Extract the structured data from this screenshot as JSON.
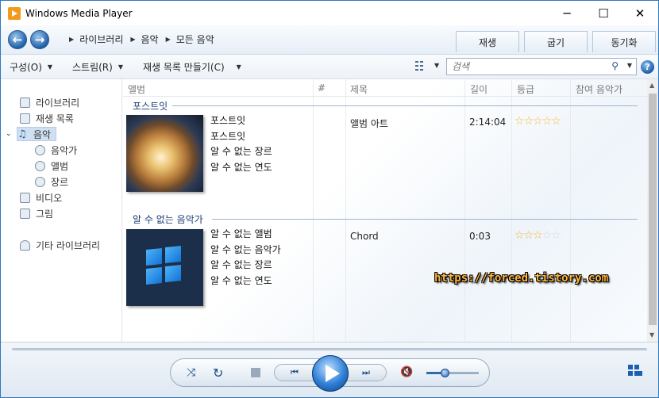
{
  "window": {
    "title": "Windows Media Player",
    "controls": {
      "minimize": "─",
      "maximize": "☐",
      "close": "✕"
    }
  },
  "nav": {
    "breadcrumb": [
      "라이브러리",
      "음악",
      "모든 음악"
    ],
    "tabs": [
      "재생",
      "굽기",
      "동기화"
    ]
  },
  "toolbar": {
    "organize": "구성(O)",
    "stream": "스트림(R)",
    "create_playlist": "재생 목록 만들기(C)",
    "search_placeholder": "검색",
    "help": "?"
  },
  "sidebar": {
    "items": [
      {
        "label": "라이브러리",
        "icon": "library-icon"
      },
      {
        "label": "재생 목록",
        "icon": "playlist-icon"
      },
      {
        "label": "음악",
        "icon": "music-note-icon",
        "selected": true
      },
      {
        "label": "음악가",
        "icon": "artist-icon"
      },
      {
        "label": "앨범",
        "icon": "album-icon"
      },
      {
        "label": "장르",
        "icon": "genre-icon"
      },
      {
        "label": "비디오",
        "icon": "video-icon"
      },
      {
        "label": "그림",
        "icon": "picture-icon"
      },
      {
        "label": "기타 라이브러리",
        "icon": "other-library-icon"
      }
    ]
  },
  "columns": [
    "앨범",
    "#",
    "제목",
    "길이",
    "등급",
    "참여 음악가"
  ],
  "groups": [
    {
      "title": "포스트잇",
      "album_lines": [
        "포스트잇",
        "포스트잇",
        "알 수 없는 장르",
        "알 수 없는 연도"
      ],
      "track": {
        "title": "앨범 아트",
        "length": "2:14:04",
        "rating": 0
      },
      "art": "frozen-bubble-art"
    },
    {
      "title": "알 수 없는 음악가",
      "album_lines": [
        "알 수 없는 앨범",
        "알 수 없는 음악가",
        "알 수 없는 장르",
        "알 수 없는 연도"
      ],
      "track": {
        "title": "Chord",
        "length": "0:03",
        "rating": 3
      },
      "art": "windows-logo-art"
    }
  ],
  "watermark": "https://forced.tistory.com",
  "player": {
    "volume": 0.35
  },
  "colors": {
    "accent": "#2b79c2",
    "star_on": "#f2b92c",
    "star_off": "#d4d8dd",
    "watermark": "#ffb43a"
  }
}
